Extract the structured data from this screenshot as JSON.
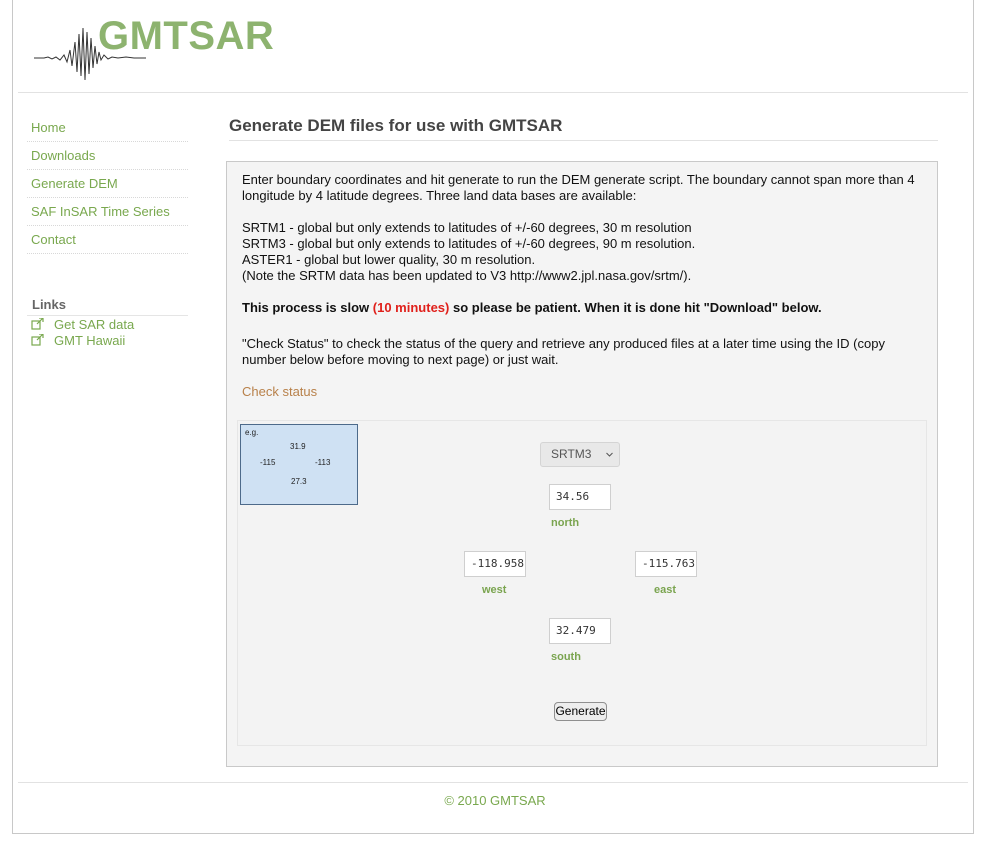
{
  "header": {
    "logo_text": "GMTSAR"
  },
  "sidebar": {
    "nav": [
      {
        "label": "Home"
      },
      {
        "label": "Downloads"
      },
      {
        "label": "Generate DEM"
      },
      {
        "label": "SAF InSAR Time Series"
      },
      {
        "label": "Contact"
      }
    ],
    "links_title": "Links",
    "links": [
      {
        "label": "Get SAR data",
        "icon": "external-link-icon"
      },
      {
        "label": "GMT Hawaii",
        "icon": "external-link-icon"
      }
    ]
  },
  "main": {
    "title": "Generate DEM files for use with GMTSAR",
    "intro": "Enter boundary coordinates and hit generate to run the DEM generate script. The boundary cannot span more than 4 longitude by 4 latitude degrees. Three land data bases are available:",
    "databases": [
      "SRTM1 - global but only extends to latitudes of +/-60 degrees, 30 m resolution",
      "SRTM3 - global but only extends to latitudes of +/-60 degrees, 90 m resolution.",
      "ASTER1 - global but lower quality, 30 m resolution.",
      "(Note the SRTM data has been updated to V3 http://www2.jpl.nasa.gov/srtm/)."
    ],
    "slow_note_prefix": "This process is slow ",
    "slow_note_red": "(10 minutes)",
    "slow_note_suffix": " so please be patient. When it is done hit \"Download\" below.",
    "status_note": "\"Check Status\" to check the status of the query and retrieve any produced files at a later time using the ID (copy number below before moving to next page) or just wait.",
    "check_status_label": "Check status"
  },
  "form": {
    "example": {
      "label": "e.g.",
      "north": "31.9",
      "west": "-115",
      "east": "-113",
      "south": "27.3"
    },
    "database_selected": "SRTM3",
    "north": {
      "value": "34.56",
      "label": "north"
    },
    "west": {
      "value": "-118.958",
      "label": "west"
    },
    "east": {
      "value": "-115.763",
      "label": "east"
    },
    "south": {
      "value": "32.479",
      "label": "south"
    },
    "generate_label": "Generate"
  },
  "footer": {
    "text": "© 2010 GMTSAR"
  },
  "colors": {
    "brand_green": "#8db36f",
    "link_green": "#79a84e",
    "warning_red": "#e0201b",
    "status_link": "#b8814a"
  }
}
